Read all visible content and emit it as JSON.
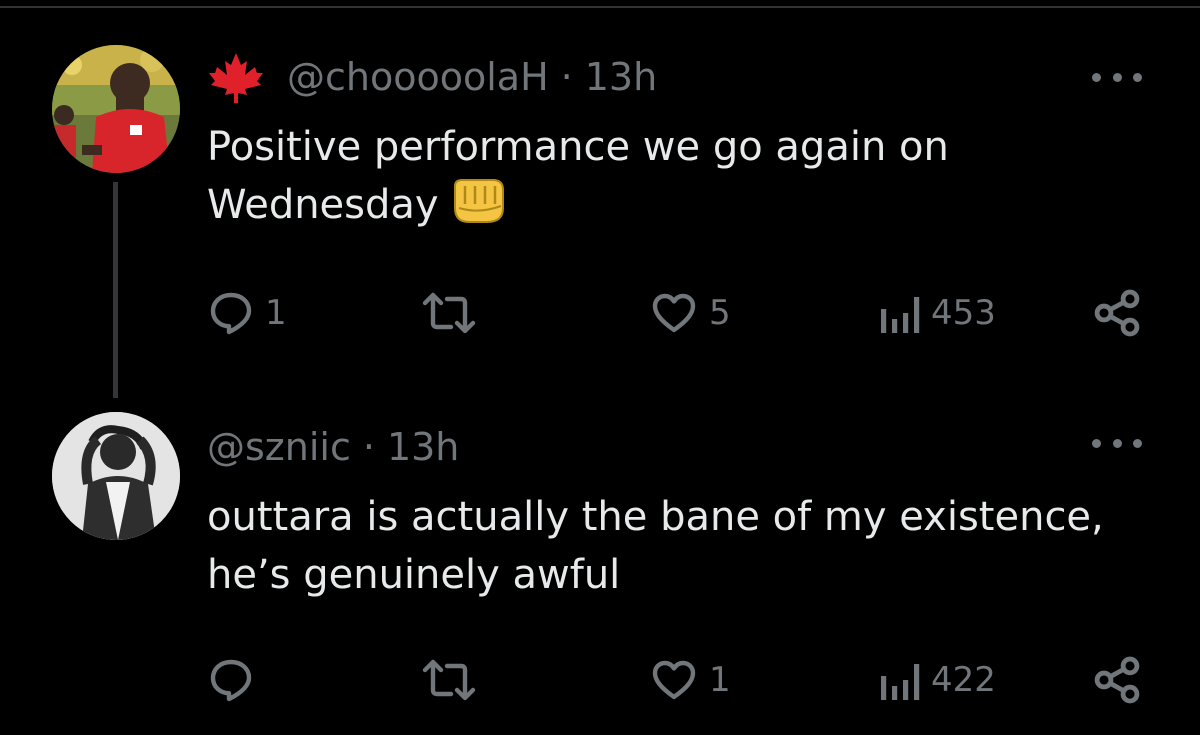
{
  "tweets": [
    {
      "flag_icon": "maple-leaf-icon",
      "handle": "@chooooolaH",
      "separator": "·",
      "time": "13h",
      "text_lines": [
        "Positive performance we go again on",
        "Wednesday"
      ],
      "emoji": "fist-emoji",
      "replies": "1",
      "retweets": "",
      "likes": "5",
      "views": "453",
      "has_thread_line": true
    },
    {
      "handle": "@szniic",
      "separator": "·",
      "time": "13h",
      "text_lines": [
        "outtara is actually the bane of my existence,",
        "he’s genuinely awful"
      ],
      "replies": "",
      "retweets": "",
      "likes": "1",
      "views": "422"
    }
  ],
  "colors": {
    "background": "#000000",
    "text_primary": "#e7e9ea",
    "text_secondary": "#71767b",
    "thread_line": "#333639",
    "maple_leaf": "#e0202a",
    "fist": "#f4c542"
  },
  "icons": [
    "reply-icon",
    "retweet-icon",
    "like-icon",
    "views-icon",
    "share-icon",
    "more-icon"
  ]
}
